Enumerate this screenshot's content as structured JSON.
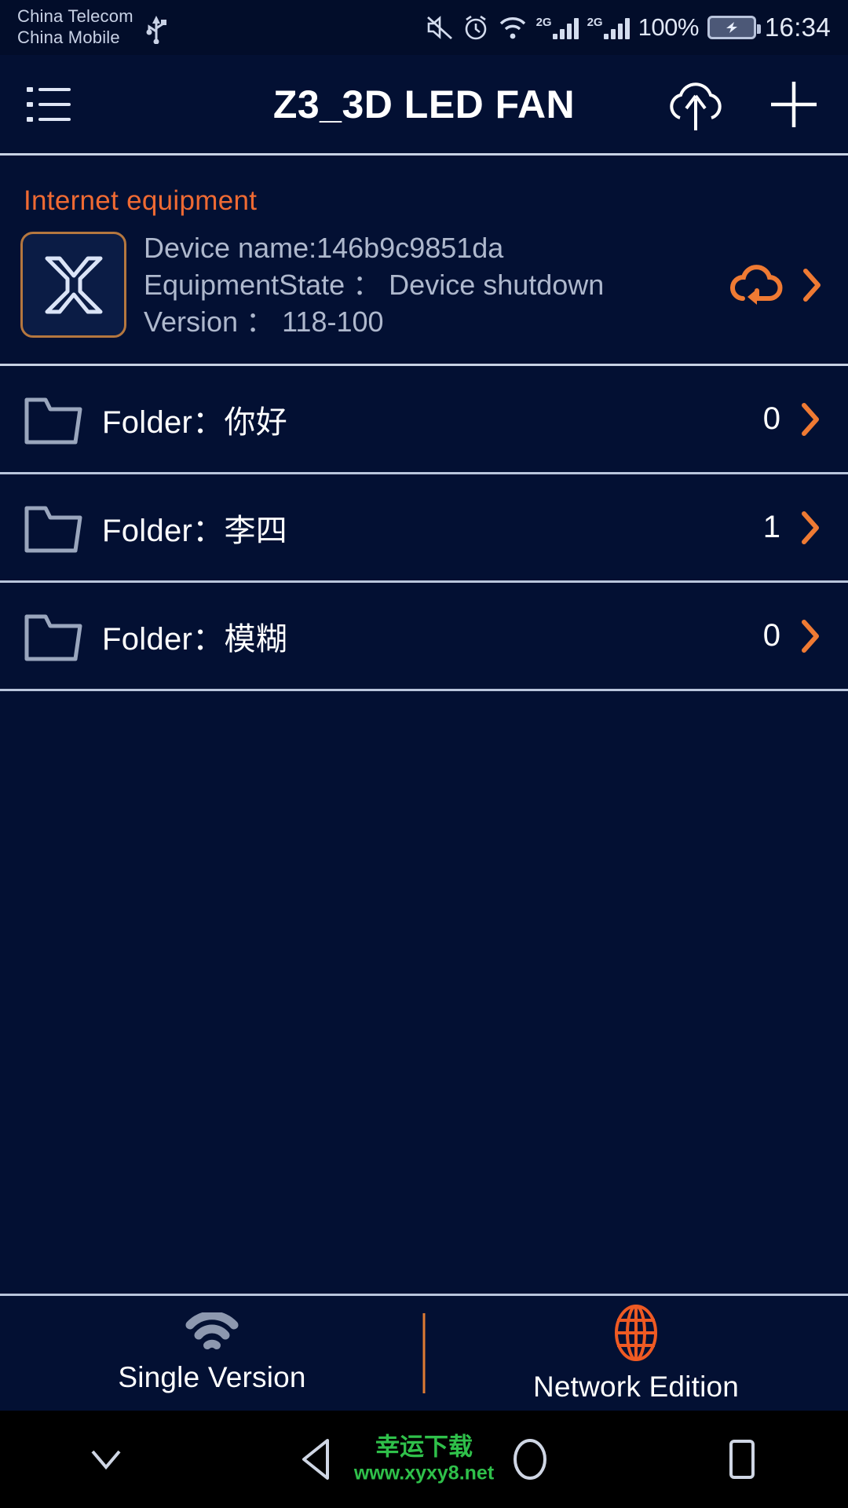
{
  "statusbar": {
    "carrier_primary": "China Telecom",
    "carrier_secondary": "China Mobile",
    "usb_icon": "usb-icon",
    "mute_icon": "mute-icon",
    "alarm_icon": "alarm-clock-icon",
    "wifi_icon": "wifi-icon",
    "network_type_1": "2G",
    "network_type_2": "2G",
    "battery_percent": "100%",
    "battery_icon": "battery-charging-icon",
    "time": "16:34"
  },
  "appbar": {
    "menu_icon": "list-menu-icon",
    "title": "Z3_3D LED FAN",
    "upload_icon": "cloud-upload-icon",
    "add_icon": "plus-icon"
  },
  "device_section": {
    "label": "Internet equipment",
    "thumb_icon": "fan-blade-x-icon",
    "device_name": "Device name:146b9c9851da",
    "equipment_state": "EquipmentState ： Device shutdown",
    "version": "Version ： 118-100",
    "sync_icon": "cloud-sync-icon",
    "chevron_icon": "chevron-right-icon"
  },
  "folders": [
    {
      "icon": "folder-icon",
      "name": "Folder：你好",
      "count": "0",
      "chevron": "chevron-right-icon"
    },
    {
      "icon": "folder-icon",
      "name": "Folder：李四",
      "count": "1",
      "chevron": "chevron-right-icon"
    },
    {
      "icon": "folder-icon",
      "name": "Folder：模糊",
      "count": "0",
      "chevron": "chevron-right-icon"
    }
  ],
  "tabs": [
    {
      "icon": "wifi-icon",
      "label": "Single Version",
      "active": false
    },
    {
      "icon": "globe-icon",
      "label": "Network Edition",
      "active": true
    }
  ],
  "navbar": {
    "collapse_icon": "chevron-down-icon",
    "back_icon": "back-triangle-icon",
    "home_icon": "home-circle-icon",
    "recents_icon": "recents-square-icon"
  },
  "watermark": {
    "line1": "幸运下载",
    "line2": "www.xyxy8.net"
  },
  "colors": {
    "background": "#031033",
    "accent_orange": "#ef6a33",
    "divider": "#c8d2e4",
    "text_primary": "#ffffff",
    "text_muted": "#aeb8cd"
  }
}
